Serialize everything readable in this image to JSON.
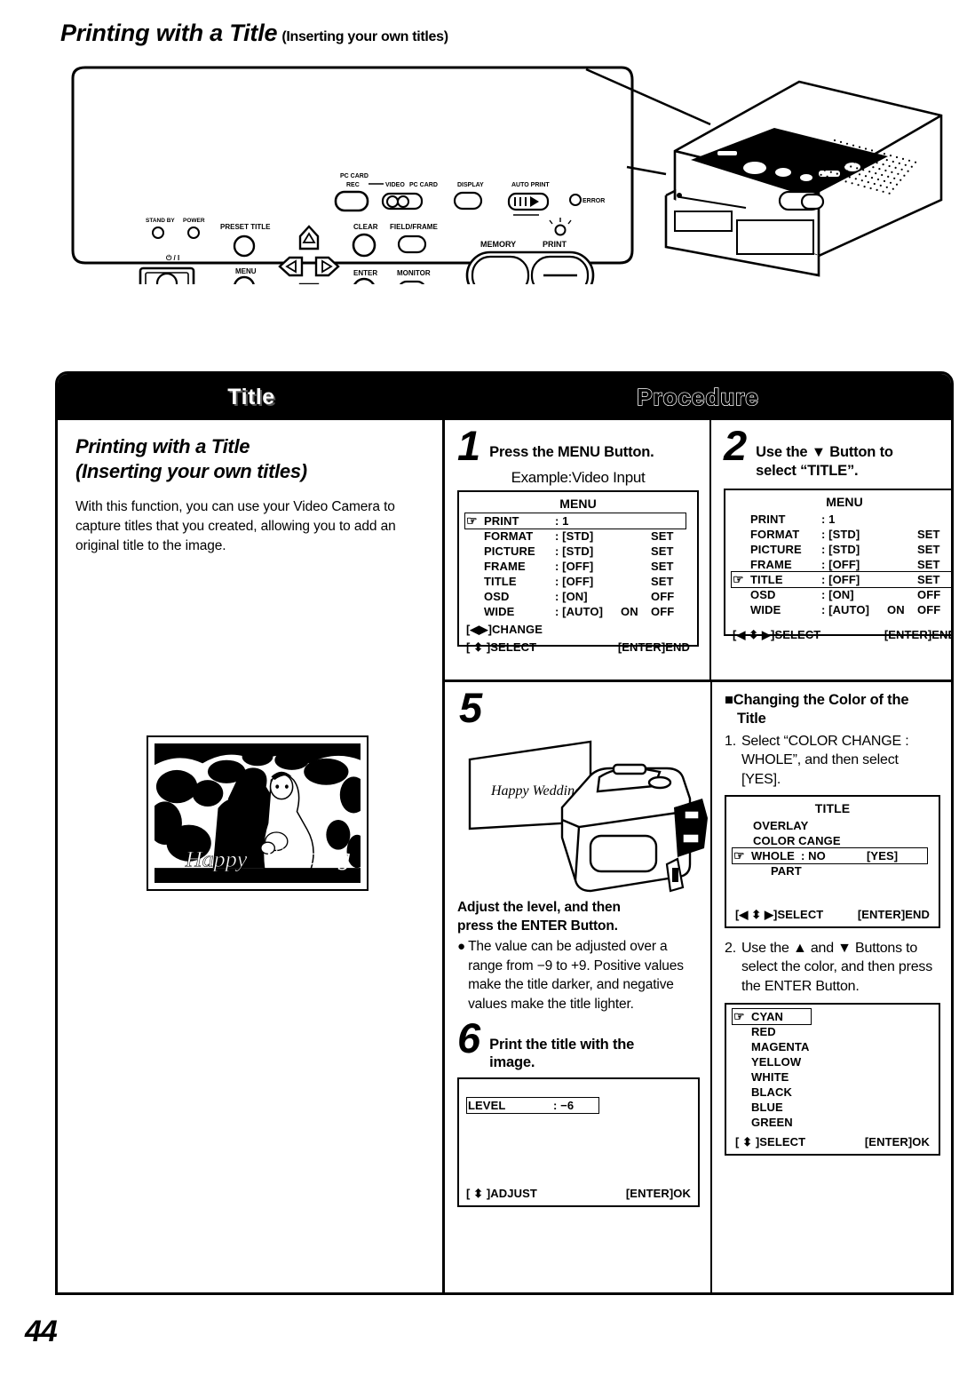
{
  "heading": {
    "main": "Printing with a Title",
    "sub": "(Inserting your own titles)"
  },
  "device_panel": {
    "labels": {
      "pc_card": "PC CARD",
      "rec": "REC",
      "video": "VIDEO",
      "pc_card2": "PC CARD",
      "display": "DISPLAY",
      "auto_print": "AUTO PRINT",
      "error": "ERROR",
      "stand_by": "STAND BY",
      "power": "POWER",
      "power_symbol": "⏻ / I",
      "preset_title": "PRESET TITLE",
      "menu": "MENU",
      "clear": "CLEAR",
      "enter": "ENTER",
      "field_frame": "FIELD/FRAME",
      "monitor": "MONITOR",
      "memory": "MEMORY",
      "print": "PRINT"
    }
  },
  "table": {
    "header": {
      "title_col": "Title",
      "procedure_col": "Procedure"
    },
    "title_cell": {
      "heading_line1": "Printing with a Title",
      "heading_line2": "(Inserting your own titles)",
      "body": "With this function, you can use your Video Camera to capture titles that you created, allowing you to add an original title to the image.",
      "photo_caption": "Happy Wedding"
    },
    "steps": [
      {
        "number": "1",
        "instruction": "Press the MENU Button.",
        "example_label": "Example:Video Input"
      },
      {
        "number": "2",
        "instruction_line1": "Use the ▼ Button to",
        "instruction_line2": "select “TITLE”."
      },
      {
        "number": "5",
        "card_text": "Happy Wedding",
        "instruction_line1": "Adjust the level, and then",
        "instruction_line2": "press the ENTER Button.",
        "bullet": "The value can be adjusted over a range from −9 to +9. Positive values make the title darker, and negative values make the title lighter."
      },
      {
        "number": "6",
        "instruction_line1": "Print the title with the",
        "instruction_line2": "image."
      }
    ],
    "color_section": {
      "heading_line1": "■Changing the Color of the",
      "heading_line2": "Title",
      "item1_num": "1.",
      "item1_text": "Select “COLOR CHANGE : WHOLE”, and then select [YES].",
      "item2_num": "2.",
      "item2_text": "Use the ▲ and ▼ Buttons to select the color, and then press the ENTER Button."
    }
  },
  "osd_screens": {
    "menu_step1": {
      "title": "MENU",
      "cursor_row": 0,
      "rows": [
        {
          "cursor": "☞",
          "label": "PRINT",
          "value": ": 1",
          "mid": "",
          "opt": "",
          "selected": true
        },
        {
          "cursor": "",
          "label": "FORMAT",
          "value": ": [STD]",
          "mid": "",
          "opt": "SET",
          "selected": false
        },
        {
          "cursor": "",
          "label": "PICTURE",
          "value": ": [STD]",
          "mid": "",
          "opt": "SET",
          "selected": false
        },
        {
          "cursor": "",
          "label": "FRAME",
          "value": ": [OFF]",
          "mid": "",
          "opt": "SET",
          "selected": false
        },
        {
          "cursor": "",
          "label": "TITLE",
          "value": ": [OFF]",
          "mid": "",
          "opt": "SET",
          "selected": false
        },
        {
          "cursor": "",
          "label": "OSD",
          "value": ": [ON]",
          "mid": "",
          "opt": "OFF",
          "selected": false
        },
        {
          "cursor": "",
          "label": "WIDE",
          "value": ": [AUTO]",
          "mid": "ON",
          "opt": "OFF",
          "selected": false
        }
      ],
      "footer_line1": "[◀▶]CHANGE",
      "footer_left": "[ ⬍ ]SELECT",
      "footer_right": "[ENTER]END"
    },
    "menu_step2": {
      "title": "MENU",
      "rows": [
        {
          "cursor": "",
          "label": "PRINT",
          "value": ": 1",
          "mid": "",
          "opt": "",
          "selected": false
        },
        {
          "cursor": "",
          "label": "FORMAT",
          "value": ": [STD]",
          "mid": "",
          "opt": "SET",
          "selected": false
        },
        {
          "cursor": "",
          "label": "PICTURE",
          "value": ": [STD]",
          "mid": "",
          "opt": "SET",
          "selected": false
        },
        {
          "cursor": "",
          "label": "FRAME",
          "value": ": [OFF]",
          "mid": "",
          "opt": "SET",
          "selected": false
        },
        {
          "cursor": "☞",
          "label": "TITLE",
          "value": ": [OFF]",
          "mid": "",
          "opt": "SET",
          "selected": true
        },
        {
          "cursor": "",
          "label": "OSD",
          "value": ": [ON]",
          "mid": "",
          "opt": "OFF",
          "selected": false
        },
        {
          "cursor": "",
          "label": "WIDE",
          "value": ": [AUTO]",
          "mid": "ON",
          "opt": "OFF",
          "selected": false
        }
      ],
      "footer_left": "[◀ ⬍ ▶]SELECT",
      "footer_right": "[ENTER]END"
    },
    "level_screen": {
      "label": "LEVEL",
      "value": ": −6",
      "footer_left": "[ ⬍ ]ADJUST",
      "footer_right": "[ENTER]OK"
    },
    "title_screen": {
      "title": "TITLE",
      "row_overlay": "OVERLAY",
      "row_color_change": "COLOR CANGE",
      "row_whole_cursor": "☞",
      "row_whole_label": "WHOLE",
      "row_whole_value": ": NO",
      "row_whole_yes": "[YES]",
      "row_part": "PART",
      "footer_left": "[◀ ⬍ ▶]SELECT",
      "footer_right": "[ENTER]END"
    },
    "color_screen": {
      "cursor": "☞",
      "colors": [
        "CYAN",
        "RED",
        "MAGENTA",
        "YELLOW",
        "WHITE",
        "BLACK",
        "BLUE",
        "GREEN"
      ],
      "footer_left": "[ ⬍ ]SELECT",
      "footer_right": "[ENTER]OK"
    }
  },
  "page_number": "44"
}
